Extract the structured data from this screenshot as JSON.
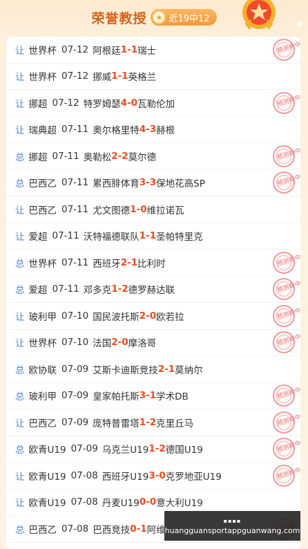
{
  "header": {
    "title": "荣誉教授",
    "record": "近19中12",
    "badge_icon": "medal-icon",
    "trophy_icon": "star-trophy-icon"
  },
  "stamp_text": "预测命中",
  "rows": [
    {
      "type": "让",
      "league": "世界杯",
      "date": "07-12",
      "home": "阿根廷",
      "hs": "1",
      "sep": " - ",
      "as": "1",
      "away": "瑞士",
      "hit": true
    },
    {
      "type": "让",
      "league": "世界杯",
      "date": "07-12",
      "home": "挪威",
      "hs": "1",
      "sep": " - ",
      "as": "1",
      "away": "英格兰",
      "hit": false
    },
    {
      "type": "让",
      "league": "挪超",
      "date": "07-12",
      "home": "特罗姆瑟",
      "hs": "4",
      "sep": " - ",
      "as": "0",
      "away": "瓦勒伦加",
      "hit": true
    },
    {
      "type": "让",
      "league": "瑞典超",
      "date": "07-11",
      "home": "奥尔格里特",
      "hs": "4",
      "sep": " - ",
      "as": "3",
      "away": "赫根",
      "hit": false
    },
    {
      "type": "总",
      "league": "挪超",
      "date": "07-11",
      "home": "奥勒松",
      "hs": "2",
      "sep": " - ",
      "as": "2",
      "away": "莫尔德",
      "hit": true
    },
    {
      "type": "总",
      "league": "巴西乙",
      "date": "07-11",
      "home": "累西腓体育",
      "hs": "3",
      "sep": " - ",
      "as": "3",
      "away": "保地花高SP",
      "hit": true
    },
    {
      "type": "让",
      "league": "巴西乙",
      "date": "07-11",
      "home": "尤文图德",
      "hs": "1",
      "sep": " - ",
      "as": "0",
      "away": "维拉诺瓦",
      "hit": false
    },
    {
      "type": "让",
      "league": "爱超",
      "date": "07-11",
      "home": "沃特福德联队",
      "hs": "1",
      "sep": " - ",
      "as": "1",
      "away": "圣帕特里克",
      "hit": false
    },
    {
      "type": "总",
      "league": "世界杯",
      "date": "07-11",
      "home": "西班牙",
      "hs": "2",
      "sep": " - ",
      "as": "1",
      "away": "比利时",
      "hit": true
    },
    {
      "type": "总",
      "league": "爱超",
      "date": "07-11",
      "home": "邓多克",
      "hs": "1",
      "sep": " - ",
      "as": "2",
      "away": "德罗赫达联",
      "hit": true
    },
    {
      "type": "让",
      "league": "玻利甲",
      "date": "07-10",
      "home": "国民波托斯",
      "hs": "2",
      "sep": " - ",
      "as": "0",
      "away": "欧若拉",
      "hit": true
    },
    {
      "type": "让",
      "league": "世界杯",
      "date": "07-10",
      "home": "法国",
      "hs": "2",
      "sep": " - ",
      "as": "0",
      "away": "摩洛哥",
      "hit": true
    },
    {
      "type": "总",
      "league": "欧协联",
      "date": "07-09",
      "home": "艾斯卡迪斯竞技",
      "hs": "2",
      "sep": " - ",
      "as": "1",
      "away": "莫纳尔",
      "hit": false
    },
    {
      "type": "总",
      "league": "玻利甲",
      "date": "07-09",
      "home": "皇家帕托斯",
      "hs": "3",
      "sep": " - ",
      "as": "1",
      "away": "学术DB",
      "hit": true
    },
    {
      "type": "让",
      "league": "巴西乙",
      "date": "07-09",
      "home": "庞特普雷塔",
      "hs": "1",
      "sep": " - ",
      "as": "2",
      "away": "克里丘马",
      "hit": true
    },
    {
      "type": "总",
      "league": "欧青U19",
      "date": "07-09",
      "home": "乌克兰U19",
      "hs": "1",
      "sep": " - ",
      "as": "2",
      "away": "德国U19",
      "hit": true
    },
    {
      "type": "让",
      "league": "欧青U19",
      "date": "07-08",
      "home": "西班牙U19",
      "hs": "3",
      "sep": " - ",
      "as": "0",
      "away": "克罗地亚U19",
      "hit": true
    },
    {
      "type": "让",
      "league": "欧青U19",
      "date": "07-08",
      "home": "丹麦U19",
      "hs": "0",
      "sep": " - ",
      "as": "0",
      "away": "意大利U19",
      "hit": false
    },
    {
      "type": "总",
      "league": "巴西乙",
      "date": "07-08",
      "home": "巴西竞技",
      "hs": "0",
      "sep": " - ",
      "as": "1",
      "away": "阿维",
      "hit": true
    }
  ],
  "watermark": {
    "icon_text": "▪▪▪▪",
    "url": "huangguansportappguanwang.com"
  }
}
